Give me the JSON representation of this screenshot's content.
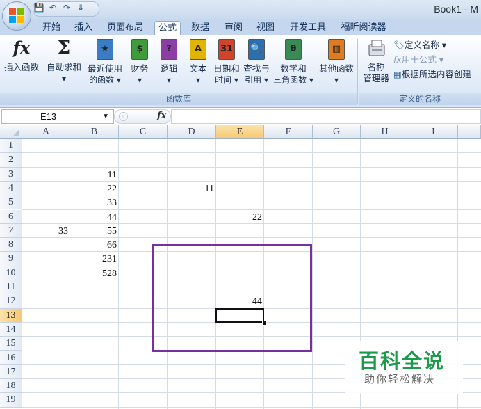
{
  "window": {
    "title": "Book1 - M"
  },
  "quick_access": [
    {
      "icon": "save-icon",
      "glyph": "💾"
    },
    {
      "icon": "undo-icon",
      "glyph": "↶"
    },
    {
      "icon": "redo-icon",
      "glyph": "↷"
    },
    {
      "icon": "customize-icon",
      "glyph": "⇓"
    }
  ],
  "tabs": [
    "开始",
    "插入",
    "页面布局",
    "公式",
    "数据",
    "审阅",
    "视图",
    "开发工具",
    "福昕阅读器"
  ],
  "active_tab": "公式",
  "ribbon": {
    "function_library": {
      "label": "函数库",
      "buttons": [
        {
          "line1": "插入函数",
          "line2": "",
          "icon": "insert-function-icon"
        },
        {
          "line1": "自动求和",
          "line2": "▾",
          "icon": "autosum-icon"
        },
        {
          "line1": "最近使用",
          "line2": "的函数 ▾",
          "icon": "recent-functions-icon"
        },
        {
          "line1": "财务",
          "line2": "▾",
          "icon": "financial-icon"
        },
        {
          "line1": "逻辑",
          "line2": "▾",
          "icon": "logical-icon"
        },
        {
          "line1": "文本",
          "line2": "▾",
          "icon": "text-icon"
        },
        {
          "line1": "日期和",
          "line2": "时间 ▾",
          "icon": "date-time-icon"
        },
        {
          "line1": "查找与",
          "line2": "引用 ▾",
          "icon": "lookup-reference-icon"
        },
        {
          "line1": "数学和",
          "line2": "三角函数 ▾",
          "icon": "math-trig-icon"
        },
        {
          "line1": "其他函数",
          "line2": "▾",
          "icon": "more-functions-icon"
        }
      ]
    },
    "defined_names": {
      "label": "定义的名称",
      "name_manager_line1": "名称",
      "name_manager_line2": "管理器",
      "define_name": "定义名称 ▾",
      "use_in_formula": "用于公式 ▾",
      "create_from_selection": "根据所选内容创建"
    }
  },
  "formula_bar": {
    "name_box": "E13",
    "fx_label": "fx",
    "formula": ""
  },
  "sheet": {
    "columns": [
      "A",
      "B",
      "C",
      "D",
      "E",
      "F",
      "G",
      "H",
      "I"
    ],
    "rows": [
      "1",
      "2",
      "3",
      "4",
      "5",
      "6",
      "7",
      "8",
      "9",
      "10",
      "11",
      "12",
      "13",
      "14",
      "15",
      "16",
      "17",
      "18",
      "19"
    ],
    "active_column": "E",
    "active_row": "13",
    "cells": [
      {
        "ref": "B3",
        "value": "11"
      },
      {
        "ref": "B4",
        "value": "22"
      },
      {
        "ref": "D4",
        "value": "11"
      },
      {
        "ref": "B5",
        "value": "33"
      },
      {
        "ref": "B6",
        "value": "44"
      },
      {
        "ref": "E6",
        "value": "22"
      },
      {
        "ref": "A7",
        "value": "33"
      },
      {
        "ref": "B7",
        "value": "55"
      },
      {
        "ref": "B8",
        "value": "66"
      },
      {
        "ref": "B9",
        "value": "231"
      },
      {
        "ref": "B10",
        "value": "528"
      },
      {
        "ref": "E12",
        "value": "44"
      }
    ],
    "highlight_color": "#7a2fa0"
  },
  "watermark": {
    "title": "百科全说",
    "subtitle": "助你轻松解决"
  }
}
